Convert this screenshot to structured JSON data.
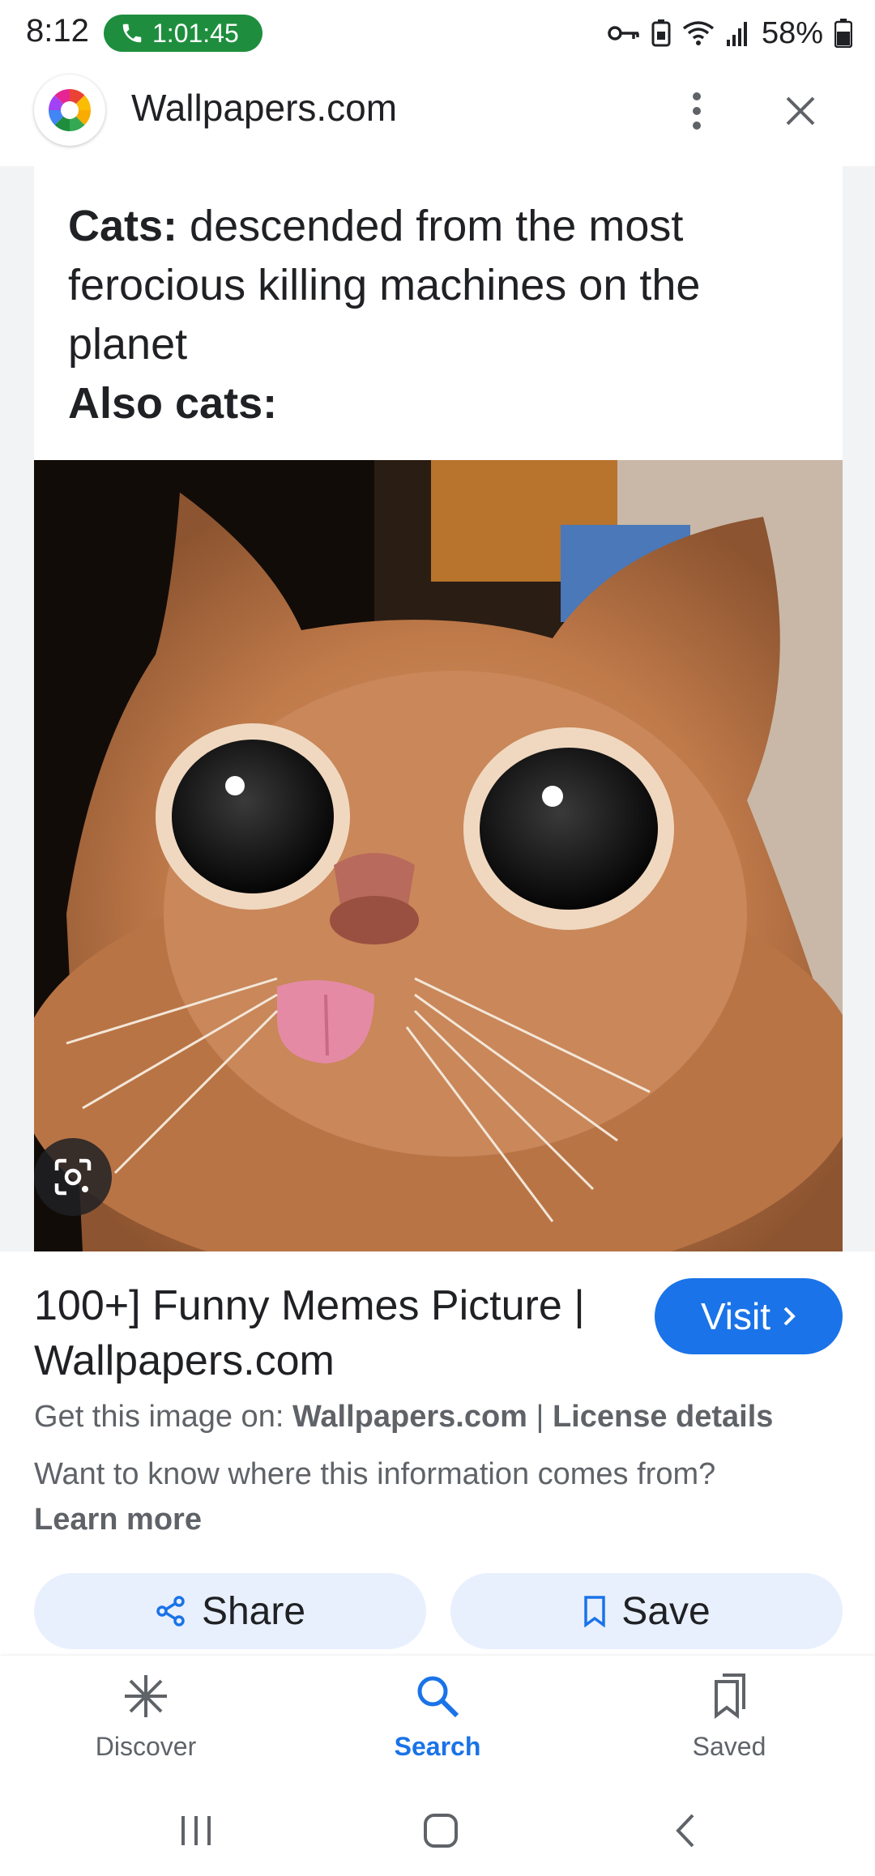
{
  "status_bar": {
    "time": "8:12",
    "call_timer": "1:01:45",
    "battery": "58%"
  },
  "browser": {
    "site_title": "Wallpapers.com"
  },
  "meme": {
    "caption_line1_bold": "Cats:",
    "caption_line1_rest": " descended from the most ferocious killing machines on the planet",
    "caption_line2_bold": "Also cats:"
  },
  "result": {
    "title": "100+] Funny Memes Picture | Wallpapers.com",
    "visit_label": "Visit",
    "source_prefix": "Get this image on: ",
    "source_site": "Wallpapers.com",
    "source_sep": " | ",
    "license_label": "License details",
    "info_text": "Want to know where this information comes from? ",
    "learn_more": "Learn more"
  },
  "actions": {
    "share_label": "Share",
    "save_label": "Save"
  },
  "bottom_nav": {
    "items": [
      {
        "label": "Discover",
        "icon": "asterisk-icon",
        "active": false
      },
      {
        "label": "Search",
        "icon": "search-icon",
        "active": true
      },
      {
        "label": "Saved",
        "icon": "bookmarks-icon",
        "active": false
      }
    ]
  },
  "colors": {
    "accent": "#1a73e8",
    "call_green": "#1e8e3e",
    "chip_bg": "#e8f0fe"
  }
}
